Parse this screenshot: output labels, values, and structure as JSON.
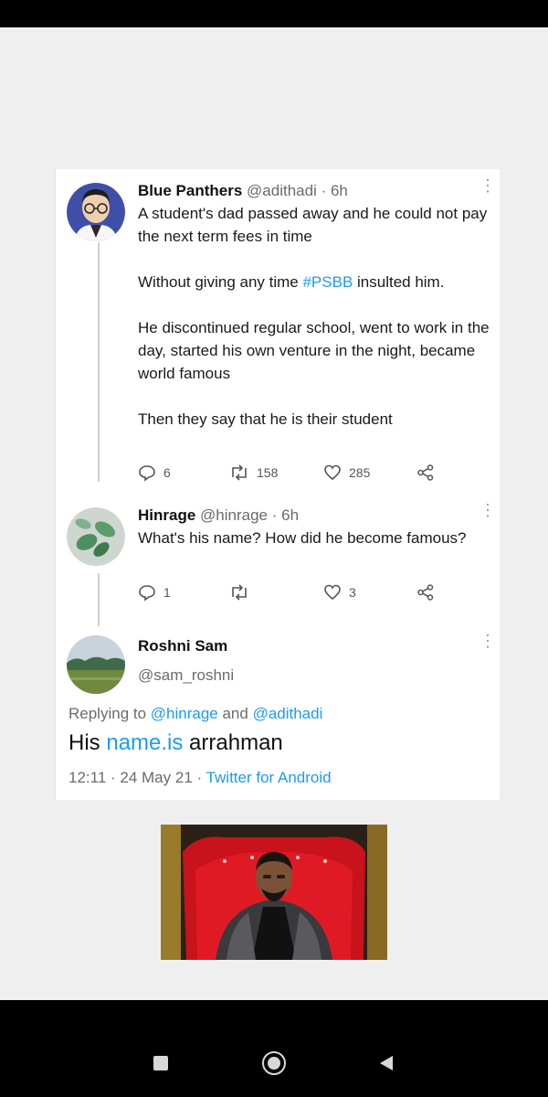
{
  "tweets": [
    {
      "name": "Blue Panthers",
      "handle": "@adithadi",
      "time": "· 6h",
      "paragraphs": [
        "A student's dad passed away and he could not pay the next term fees in time",
        "He discontinued regular school, went to work in the day, started his own venture in the night, became world famous",
        "Then they say that he is their student"
      ],
      "p2_before": "Without giving any time ",
      "p2_hashtag": "#PSBB",
      "p2_after": " insulted him.",
      "replies": "6",
      "retweets": "158",
      "likes": "285"
    },
    {
      "name": "Hinrage",
      "handle": "@hinrage",
      "time": "· 6h",
      "text": "What's his name? How did he become famous?",
      "replies": "1",
      "retweets": "",
      "likes": "3"
    }
  ],
  "main_tweet": {
    "name": "Roshni Sam",
    "handle": "@sam_roshni",
    "replying_label": "Replying to ",
    "replying_user1": "@hinrage",
    "replying_and": " and ",
    "replying_user2": "@adithadi",
    "text_before": "His ",
    "text_link": "name.is",
    "text_after": " arrahman",
    "timestamp": "12:11 · 24 May 21 · ",
    "source": "Twitter for Android"
  },
  "colors": {
    "accent": "#1d9bf0",
    "page_bg": "#efefef",
    "card_bg": "#ffffff",
    "muted": "#6b6b6b"
  },
  "icons": {
    "reply": "reply-icon",
    "retweet": "retweet-icon",
    "like": "heart-icon",
    "share": "share-icon",
    "more": "more-options-icon",
    "nav_recents": "square-icon",
    "nav_home": "circle-icon",
    "nav_back": "triangle-back-icon"
  }
}
